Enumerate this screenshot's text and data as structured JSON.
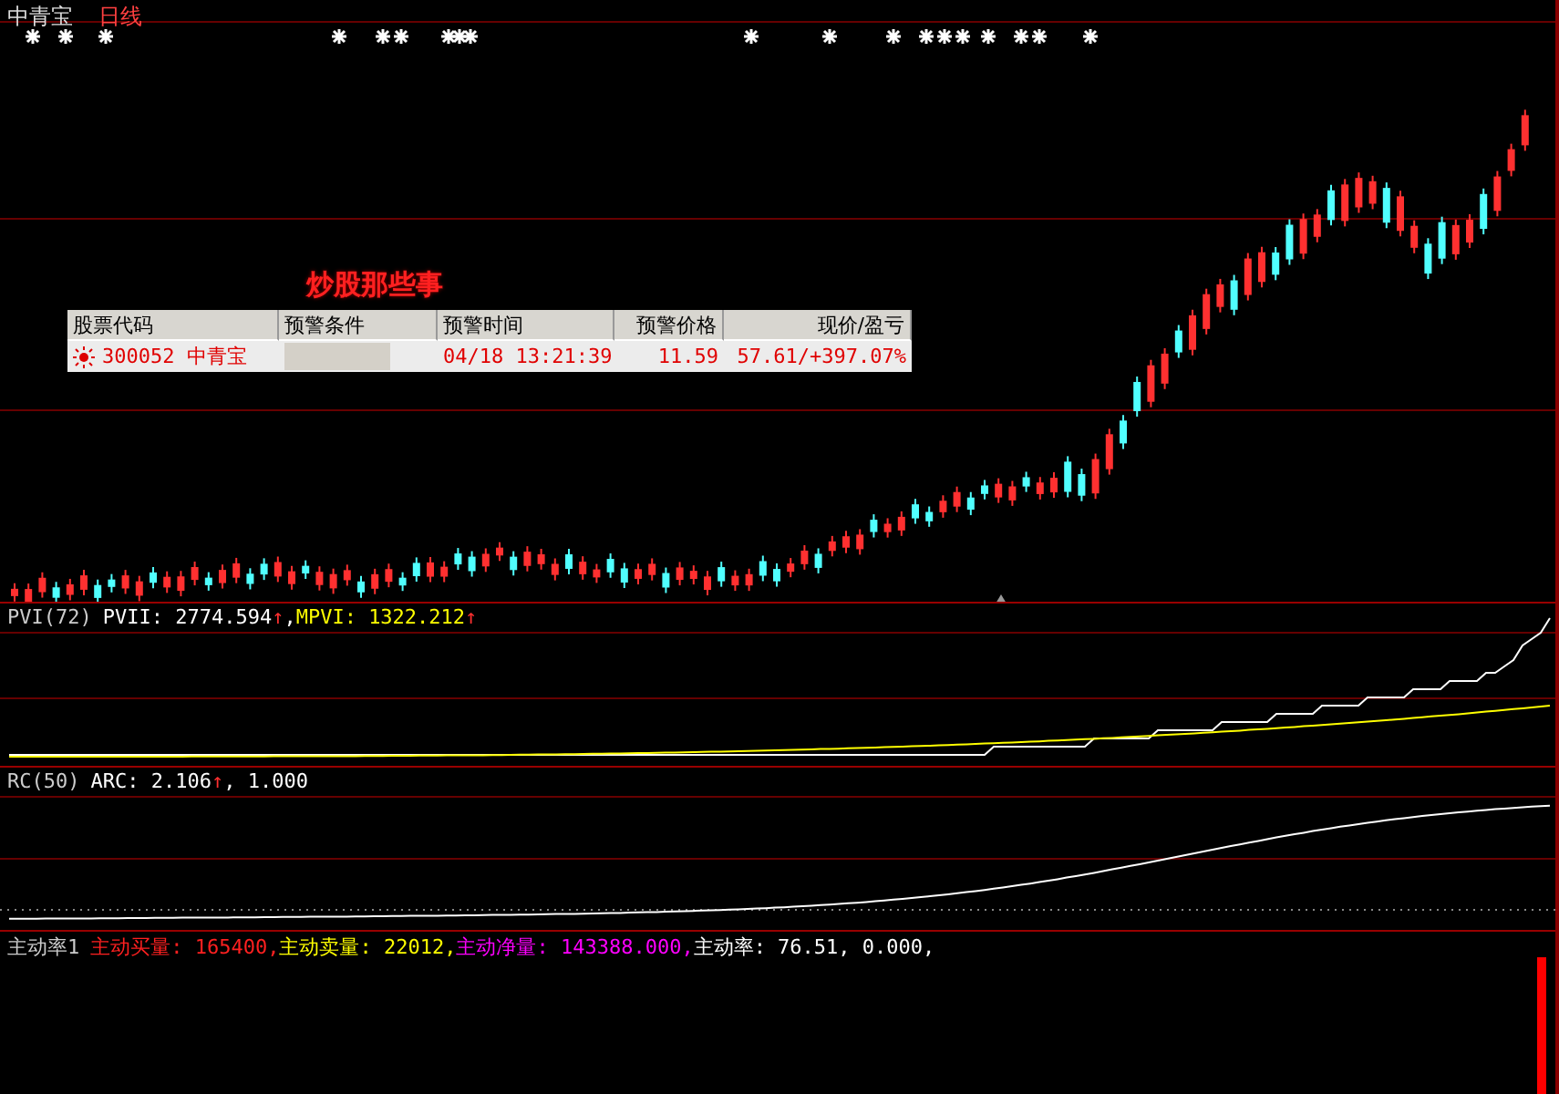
{
  "header": {
    "stock_name": "中青宝",
    "period": "日线"
  },
  "alert_window": {
    "title": "炒股那些事",
    "columns": [
      "股票代码",
      "预警条件",
      "预警时间",
      "预警价格",
      "现价/盈亏"
    ],
    "rows": [
      {
        "code": "300052 中青宝",
        "time": "04/18 13:21:39",
        "price": "11.59",
        "current": "57.61/+397.07%"
      }
    ]
  },
  "indicators": [
    {
      "label": "PVI(72)",
      "kind": "pvi",
      "items": [
        {
          "text": "PVII: 2774.594",
          "color": "#ffffff",
          "arrow": "↑"
        },
        {
          "text": ",",
          "color": "#ffffff"
        },
        {
          "text": "MPVI: 1322.212",
          "color": "#ffff00",
          "arrow": "↑"
        }
      ]
    },
    {
      "label": "RC(50)",
      "kind": "rc",
      "items": [
        {
          "text": "ARC: 2.106",
          "color": "#ffffff",
          "arrow": "↑"
        },
        {
          "text": ", 1.000",
          "color": "#ffffff"
        }
      ]
    },
    {
      "label": "主动率1",
      "kind": "bar",
      "items": [
        {
          "text": "主动买量: 165400,",
          "color": "#ff2020"
        },
        {
          "text": "主动卖量: 22012,",
          "color": "#ffff00"
        },
        {
          "text": "主动净量: 143388.000,",
          "color": "#ff00ff"
        },
        {
          "text": "主动率: 76.51, 0.000,",
          "color": "#ffffff"
        }
      ]
    }
  ]
}
